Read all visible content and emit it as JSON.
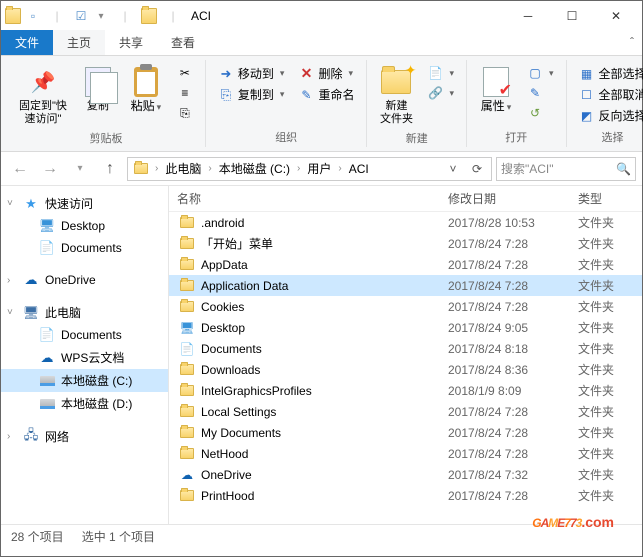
{
  "title": "ACI",
  "tabs": {
    "file": "文件",
    "home": "主页",
    "share": "共享",
    "view": "查看"
  },
  "ribbon": {
    "pin": "固定到\"快\n速访问\"",
    "copy": "复制",
    "paste": "粘贴",
    "group_clip": "剪贴板",
    "moveto": "移动到",
    "copyto": "复制到",
    "delete": "删除",
    "rename": "重命名",
    "group_org": "组织",
    "newfolder": "新建\n文件夹",
    "group_new": "新建",
    "props": "属性",
    "group_open": "打开",
    "selall": "全部选择",
    "selnone": "全部取消",
    "selinv": "反向选择",
    "group_sel": "选择"
  },
  "breadcrumb": [
    "此电脑",
    "本地磁盘 (C:)",
    "用户",
    "ACI"
  ],
  "search_placeholder": "搜索\"ACI\"",
  "columns": {
    "name": "名称",
    "date": "修改日期",
    "type": "类型"
  },
  "sidebar": {
    "quick": "快速访问",
    "desktop": "Desktop",
    "documents": "Documents",
    "onedrive": "OneDrive",
    "thispc": "此电脑",
    "documents2": "Documents",
    "wps": "WPS云文档",
    "diskc": "本地磁盘 (C:)",
    "diskd": "本地磁盘 (D:)",
    "network": "网络"
  },
  "files": [
    {
      "name": ".android",
      "date": "2017/8/28 10:53",
      "type": "文件夹",
      "icon": "folder"
    },
    {
      "name": "「开始」菜单",
      "date": "2017/8/24 7:28",
      "type": "文件夹",
      "icon": "folder"
    },
    {
      "name": "AppData",
      "date": "2017/8/24 7:28",
      "type": "文件夹",
      "icon": "folder"
    },
    {
      "name": "Application Data",
      "date": "2017/8/24 7:28",
      "type": "文件夹",
      "icon": "folder",
      "sel": true
    },
    {
      "name": "Cookies",
      "date": "2017/8/24 7:28",
      "type": "文件夹",
      "icon": "folder"
    },
    {
      "name": "Desktop",
      "date": "2017/8/24 9:05",
      "type": "文件夹",
      "icon": "desktop"
    },
    {
      "name": "Documents",
      "date": "2017/8/24 8:18",
      "type": "文件夹",
      "icon": "doc"
    },
    {
      "name": "Downloads",
      "date": "2017/8/24 8:36",
      "type": "文件夹",
      "icon": "folder"
    },
    {
      "name": "IntelGraphicsProfiles",
      "date": "2018/1/9 8:09",
      "type": "文件夹",
      "icon": "folder"
    },
    {
      "name": "Local Settings",
      "date": "2017/8/24 7:28",
      "type": "文件夹",
      "icon": "folder"
    },
    {
      "name": "My Documents",
      "date": "2017/8/24 7:28",
      "type": "文件夹",
      "icon": "folder"
    },
    {
      "name": "NetHood",
      "date": "2017/8/24 7:28",
      "type": "文件夹",
      "icon": "folder"
    },
    {
      "name": "OneDrive",
      "date": "2017/8/24 7:32",
      "type": "文件夹",
      "icon": "cloud"
    },
    {
      "name": "PrintHood",
      "date": "2017/8/24 7:28",
      "type": "文件夹",
      "icon": "folder"
    }
  ],
  "status": {
    "count": "28 个项目",
    "sel": "选中 1 个项目"
  },
  "watermark": {
    "text": "GAME773",
    "domain": ".com"
  }
}
